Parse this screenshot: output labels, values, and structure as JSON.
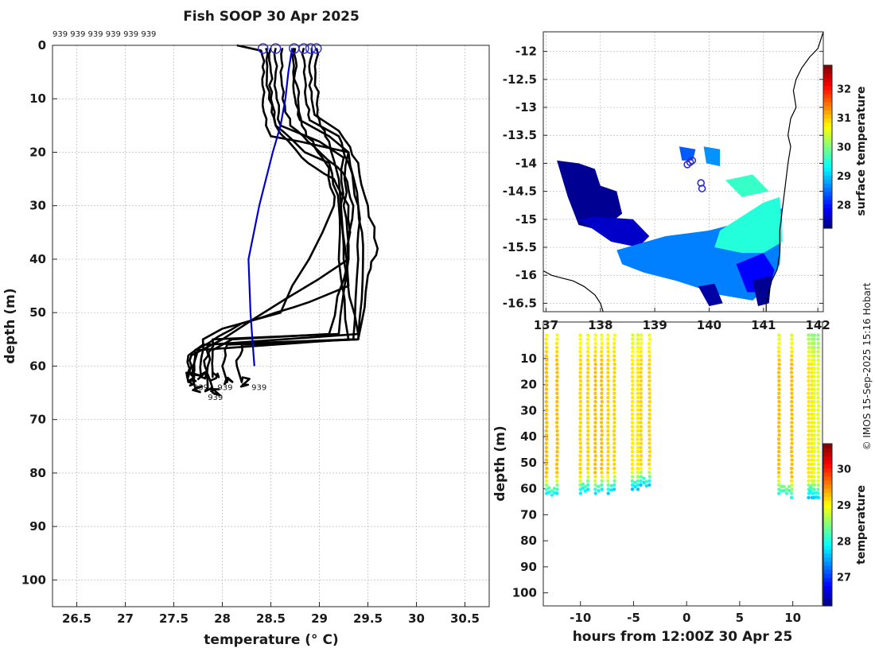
{
  "copyright": "© IMOS 15-Sep-2025 15:16 Hobart",
  "chart_data": [
    {
      "type": "line",
      "title": "Fish SOOP 30 Apr 2025",
      "xlabel": "temperature (° C)",
      "ylabel": "depth (m)",
      "xlim": [
        26.25,
        30.75
      ],
      "ylim": [
        105,
        0
      ],
      "xticks": [
        26.5,
        27,
        27.5,
        28,
        28.5,
        29,
        29.5,
        30,
        30.5
      ],
      "yticks": [
        0,
        10,
        20,
        30,
        40,
        50,
        60,
        70,
        80,
        90,
        100
      ],
      "grid": true,
      "top_annotation": "939 939 939 939 939 939",
      "bottom_annotations": [
        {
          "text": "939",
          "x": 27.7,
          "y": 64.5
        },
        {
          "text": "939",
          "x": 27.95,
          "y": 64.5
        },
        {
          "text": "939",
          "x": 28.3,
          "y": 64.5
        },
        {
          "text": "939",
          "x": 27.85,
          "y": 66.3
        }
      ],
      "start_markers": [
        {
          "x": 28.42,
          "y": 0.6
        },
        {
          "x": 28.55,
          "y": 0.6
        },
        {
          "x": 28.74,
          "y": 0.6
        },
        {
          "x": 28.84,
          "y": 0.6
        },
        {
          "x": 28.91,
          "y": 0.6
        },
        {
          "x": 28.97,
          "y": 0.6
        }
      ],
      "mean_profile": {
        "color": "#0000cc",
        "x": [
          28.72,
          28.68,
          28.65,
          28.6,
          28.52,
          28.38,
          28.27,
          28.29,
          28.31,
          28.33
        ],
        "y": [
          0.5,
          5,
          10,
          15,
          20,
          30,
          40,
          50,
          55,
          60
        ]
      },
      "profiles": [
        {
          "x": [
            28.15,
            28.4,
            28.43,
            28.42,
            28.45,
            28.5,
            28.8,
            29.3,
            29.4,
            29.4,
            29.35,
            27.8,
            27.65,
            27.65
          ],
          "y": [
            0,
            1,
            5,
            10,
            15,
            17,
            18,
            20,
            30,
            40,
            55,
            56,
            58,
            63
          ]
        },
        {
          "x": [
            28.5,
            28.5,
            28.5,
            28.55,
            28.85,
            29.1,
            29.2,
            29.2,
            29.3,
            27.75,
            27.7,
            27.72
          ],
          "y": [
            0.5,
            5,
            10,
            15,
            20,
            22,
            30,
            40,
            55,
            57,
            60,
            64
          ]
        },
        {
          "x": [
            28.55,
            28.55,
            28.56,
            28.6,
            29.0,
            29.25,
            29.22,
            29.25,
            29.4,
            27.85,
            27.82,
            27.85
          ],
          "y": [
            0.5,
            5,
            10,
            15,
            18,
            21,
            30,
            40,
            54,
            56,
            60,
            64
          ]
        },
        {
          "x": [
            28.74,
            28.73,
            28.75,
            28.8,
            29.1,
            29.3,
            29.25,
            29.3,
            29.2,
            27.9,
            27.85,
            27.9
          ],
          "y": [
            0.5,
            5,
            10,
            14,
            17,
            20,
            30,
            40,
            54,
            55,
            60,
            65
          ]
        },
        {
          "x": [
            28.84,
            28.84,
            28.86,
            28.9,
            29.2,
            29.3,
            29.4,
            29.45,
            29.4,
            28.05,
            28.0,
            28.05
          ],
          "y": [
            0.5,
            5,
            10,
            14,
            17,
            22,
            30,
            40,
            55,
            56,
            60,
            63
          ]
        },
        {
          "x": [
            28.92,
            28.9,
            28.92,
            28.95,
            29.2,
            29.4,
            29.5,
            29.6,
            29.5,
            29.4,
            28.2,
            28.15,
            28.2
          ],
          "y": [
            0.5,
            5,
            10,
            13,
            16,
            22,
            30,
            38,
            43,
            55,
            56,
            60,
            63
          ]
        },
        {
          "x": [
            28.97,
            28.96,
            28.98,
            29.0,
            29.1,
            29.2,
            29.3,
            28.9,
            28.2,
            27.72,
            27.7
          ],
          "y": [
            0.5,
            5,
            10,
            14,
            18,
            25,
            45,
            48,
            52,
            57,
            62
          ]
        },
        {
          "x": [
            28.62,
            28.6,
            28.62,
            28.7,
            28.95,
            29.1,
            29.15,
            28.6,
            28.0,
            27.8,
            27.78
          ],
          "y": [
            0.5,
            5,
            10,
            15,
            19,
            23,
            30,
            50,
            53,
            55,
            62
          ]
        },
        {
          "x": [
            28.45,
            28.46,
            28.48,
            28.55,
            28.82,
            29.15,
            29.3,
            29.3,
            29.1,
            28.1,
            27.9,
            27.9
          ],
          "y": [
            0.5,
            5,
            10,
            15,
            21,
            25,
            30,
            40,
            54,
            55,
            57,
            62
          ]
        },
        {
          "x": [
            28.75,
            28.75,
            28.78,
            28.82,
            28.95,
            29.25,
            29.35,
            29.3,
            28.0,
            27.68,
            27.65
          ],
          "y": [
            0.5,
            5,
            10,
            15,
            19,
            24,
            30,
            40,
            55,
            58,
            62
          ]
        }
      ]
    },
    {
      "type": "heatmap",
      "xticks": [
        137,
        138,
        139,
        140,
        141,
        142
      ],
      "xtick_labels": [
        "137",
        "138",
        "139",
        "140",
        "141",
        "142"
      ],
      "yticks": [
        -12,
        -12.5,
        -13,
        -13.5,
        -14,
        -14.5,
        -15,
        -15.5,
        -16,
        -16.5
      ],
      "xlim": [
        136.95,
        142.1
      ],
      "ylim": [
        -16.65,
        -11.65
      ],
      "grid": true,
      "colorbar": {
        "label": "surface temperature",
        "range": [
          27.2,
          32.8
        ],
        "ticks": [
          28,
          29,
          30,
          31,
          32
        ]
      },
      "coastline_east": {
        "lon": [
          142.1,
          142.0,
          141.85,
          141.7,
          141.6,
          141.55,
          141.6,
          141.5,
          141.45,
          141.5,
          141.45,
          141.4,
          141.35,
          141.3,
          141.3,
          141.25,
          141.15,
          141.1,
          141.05,
          141.05
        ],
        "lat": [
          -11.65,
          -11.95,
          -12.1,
          -12.3,
          -12.5,
          -12.7,
          -13.0,
          -13.2,
          -13.5,
          -13.7,
          -14.0,
          -14.4,
          -14.8,
          -15.2,
          -15.6,
          -15.9,
          -16.1,
          -16.3,
          -16.5,
          -16.65
        ]
      },
      "coastline_west": {
        "lon": [
          136.95,
          137.1,
          137.3,
          137.5,
          137.7,
          137.9,
          138.0,
          138.05
        ],
        "lat": [
          -15.92,
          -16.0,
          -16.05,
          -16.1,
          -16.2,
          -16.35,
          -16.5,
          -16.65
        ]
      },
      "ship_track": [
        {
          "lon": 139.6,
          "lat": -14.02
        },
        {
          "lon": 139.65,
          "lat": -13.98
        },
        {
          "lon": 139.69,
          "lat": -13.95
        },
        {
          "lon": 139.85,
          "lat": -14.35
        },
        {
          "lon": 139.87,
          "lat": -14.45
        }
      ],
      "sst_patches": [
        {
          "lon": [
            137.2,
            137.6,
            137.9,
            138.0,
            138.3,
            138.4,
            138.0,
            137.6,
            137.4
          ],
          "lat": [
            -13.95,
            -14.0,
            -14.1,
            -14.4,
            -14.5,
            -14.9,
            -15.2,
            -15.1,
            -14.6
          ],
          "value": 27.3
        },
        {
          "lon": [
            137.6,
            137.9,
            138.6,
            138.9,
            138.7,
            138.2
          ],
          "lat": [
            -15.0,
            -14.95,
            -15.0,
            -15.3,
            -15.5,
            -15.4
          ],
          "value": 27.6
        },
        {
          "lon": [
            138.3,
            139.2,
            140.0,
            140.8,
            141.2,
            141.35,
            141.3,
            141.1,
            140.8,
            140.2,
            139.4,
            138.8,
            138.4
          ],
          "lat": [
            -15.55,
            -15.3,
            -15.2,
            -15.0,
            -14.85,
            -14.8,
            -15.8,
            -16.2,
            -16.45,
            -16.35,
            -16.1,
            -15.95,
            -15.8
          ],
          "value": 28.6
        },
        {
          "lon": [
            140.2,
            141.0,
            141.3,
            141.35,
            141.0,
            140.6,
            140.1
          ],
          "lat": [
            -15.2,
            -14.7,
            -14.6,
            -15.4,
            -15.6,
            -15.6,
            -15.5
          ],
          "value": 29.5
        },
        {
          "lon": [
            140.5,
            141.0,
            141.2,
            141.1,
            140.7
          ],
          "lat": [
            -15.8,
            -15.6,
            -15.9,
            -16.3,
            -16.3
          ],
          "value": 27.9
        },
        {
          "lon": [
            140.8,
            141.15,
            141.1,
            140.9
          ],
          "lat": [
            -16.1,
            -16.0,
            -16.5,
            -16.55
          ],
          "value": 27.3
        },
        {
          "lon": [
            139.8,
            140.1,
            140.25,
            140.0
          ],
          "lat": [
            -16.2,
            -16.15,
            -16.5,
            -16.55
          ],
          "value": 27.4
        },
        {
          "lon": [
            140.3,
            140.8,
            141.1,
            140.6
          ],
          "lat": [
            -14.3,
            -14.2,
            -14.5,
            -14.6
          ],
          "value": 29.6
        },
        {
          "lon": [
            139.45,
            139.75,
            139.7,
            139.5
          ],
          "lat": [
            -13.7,
            -13.75,
            -13.95,
            -13.95
          ],
          "value": 28.4
        },
        {
          "lon": [
            139.9,
            140.2,
            140.2,
            139.95
          ],
          "lat": [
            -13.7,
            -13.75,
            -14.05,
            -14.0
          ],
          "value": 28.7
        }
      ]
    },
    {
      "type": "scatter",
      "xlabel": "hours from 12:00Z 30 Apr 25",
      "ylabel": "depth (m)",
      "xlim": [
        -13.5,
        12.8
      ],
      "ylim": [
        105,
        -4
      ],
      "xticks": [
        -10,
        -5,
        0,
        5,
        10
      ],
      "yticks": [
        10,
        20,
        30,
        40,
        50,
        60,
        70,
        80,
        90,
        100
      ],
      "colorbar": {
        "label": "temperature",
        "range": [
          26.2,
          30.7
        ],
        "ticks": [
          27,
          28,
          29,
          30
        ]
      },
      "casts": [
        {
          "start": -13.2,
          "end": -12.2,
          "top": 29.0,
          "mid": 29.3,
          "bottom": 27.6,
          "maxdepth": 63
        },
        {
          "start": -10.0,
          "end": -9.3,
          "top": 28.9,
          "mid": 29.2,
          "bottom": 27.6,
          "maxdepth": 62
        },
        {
          "start": -8.6,
          "end": -8.0,
          "top": 28.9,
          "mid": 29.3,
          "bottom": 27.6,
          "maxdepth": 62
        },
        {
          "start": -7.4,
          "end": -6.8,
          "top": 29.0,
          "mid": 29.2,
          "bottom": 27.5,
          "maxdepth": 62
        },
        {
          "start": -5.1,
          "end": -4.6,
          "top": 28.8,
          "mid": 29.1,
          "bottom": 27.5,
          "maxdepth": 60
        },
        {
          "start": -4.3,
          "end": -3.5,
          "top": 28.9,
          "mid": 29.2,
          "bottom": 27.5,
          "maxdepth": 60
        },
        {
          "start": 8.7,
          "end": 9.9,
          "top": 28.8,
          "mid": 29.3,
          "bottom": 27.9,
          "maxdepth": 63
        },
        {
          "start": 11.5,
          "end": 11.8,
          "top": 28.5,
          "mid": 29.1,
          "bottom": 27.6,
          "maxdepth": 63
        },
        {
          "start": 12.0,
          "end": 12.4,
          "top": 28.4,
          "mid": 28.9,
          "bottom": 27.5,
          "maxdepth": 65
        }
      ]
    }
  ]
}
